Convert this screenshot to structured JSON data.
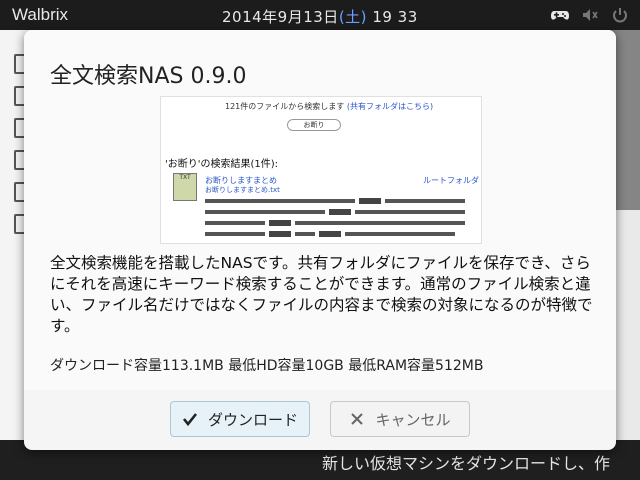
{
  "topbar": {
    "brand": "Walbrix",
    "date": "2014年9月13日",
    "weekday": "(土)",
    "time": "19 33"
  },
  "background": {
    "bottom_text": "新しい仮想マシンをダウンロードし、作"
  },
  "dialog": {
    "title": "全文検索NAS 0.9.0",
    "screenshot": {
      "header_prefix": "121件のファイルから検索します",
      "header_link": "(共有フォルダはこちら)",
      "search_value": "お断り",
      "result_heading": "'お断り'の検索結果(1件):",
      "icon_label": "TXT",
      "result_title": "お断りしますまとめ",
      "result_file": "お断りしますまとめ.txt",
      "result_folder": "ルートフォルダ"
    },
    "description": "全文検索機能を搭載したNASです。共有フォルダにファイルを保存でき、さらにそれを高速にキーワード検索することができます。通常のファイル検索と違い、ファイル名だけではなくファイルの内容まで検索の対象になるのが特徴です。",
    "specs": "ダウンロード容量113.1MB 最低HD容量10GB 最低RAM容量512MB",
    "buttons": {
      "download": "ダウンロード",
      "cancel": "キャンセル"
    }
  },
  "icons": [
    "gamepad-icon",
    "volume-icon",
    "power-icon",
    "check-icon",
    "close-icon"
  ]
}
